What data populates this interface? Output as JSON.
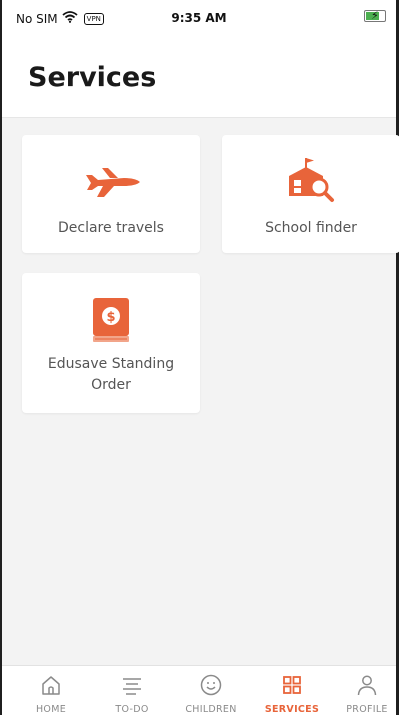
{
  "status_bar": {
    "carrier": "No SIM",
    "vpn": "VPN",
    "time": "9:35 AM"
  },
  "header": {
    "title": "Services"
  },
  "services": [
    {
      "label": "Declare travels",
      "icon": "airplane-icon"
    },
    {
      "label": "School finder",
      "icon": "school-search-icon"
    },
    {
      "label": "Edusave Standing Order",
      "icon": "dollar-book-icon"
    }
  ],
  "tabbar": {
    "active": "SERVICES",
    "items": [
      {
        "label": "HOME",
        "icon": "home-icon"
      },
      {
        "label": "TO-DO",
        "icon": "list-icon"
      },
      {
        "label": "CHILDREN",
        "icon": "smiley-icon"
      },
      {
        "label": "SERVICES",
        "icon": "grid-icon"
      },
      {
        "label": "PROFILE",
        "icon": "person-icon"
      }
    ]
  },
  "colors": {
    "accent": "#e8643a",
    "background": "#f3f3f3",
    "inactive": "#8a8a8a"
  }
}
